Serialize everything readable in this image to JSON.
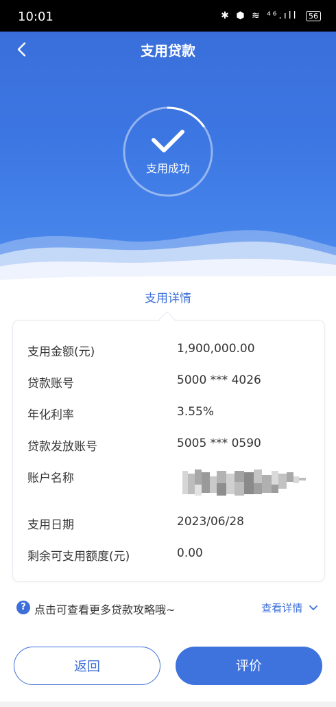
{
  "status_bar": {
    "time": "10:01",
    "icons": "✱ ⬢ ≋ ⁴⁶.ıll",
    "battery": "56"
  },
  "header": {
    "title": "支用贷款"
  },
  "result": {
    "status_text": "支用成功"
  },
  "section": {
    "title": "支用详情"
  },
  "details": [
    {
      "label": "支用金额(元)",
      "value": "1,900,000.00"
    },
    {
      "label": "贷款账号",
      "value": "5000 *** 4026"
    },
    {
      "label": "年化利率",
      "value": "3.55%"
    },
    {
      "label": "贷款发放账号",
      "value": "5005 *** 0590"
    },
    {
      "label": "账户名称",
      "value": ""
    },
    {
      "label": "支用日期",
      "value": "2023/06/28"
    },
    {
      "label": "剩余可支用额度(元)",
      "value": "0.00"
    }
  ],
  "tip": {
    "icon": "?",
    "text": "点击可查看更多贷款攻略哦~",
    "link": "查看详情"
  },
  "buttons": {
    "back": "返回",
    "evaluate": "评价"
  },
  "colors": {
    "primary": "#3e72dc",
    "hero_top": "#3a6fdb",
    "hero_bottom": "#5890ee"
  },
  "icons": {
    "back": "chevron-left-icon",
    "success": "checkmark-icon",
    "help": "question-icon",
    "expand": "chevron-down-icon"
  }
}
